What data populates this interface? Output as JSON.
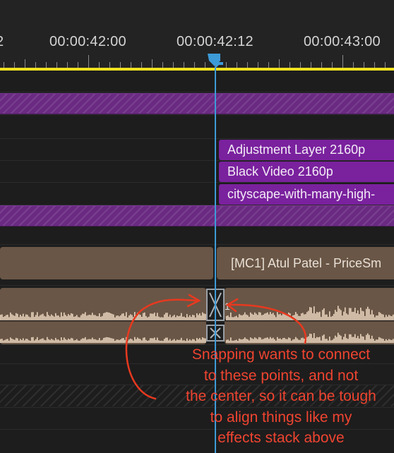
{
  "ruler": {
    "timecodes": [
      "2",
      "00:00:42:00",
      "00:00:42:12",
      "00:00:43:00"
    ]
  },
  "clips": {
    "adjustment_layer": "Adjustment Layer 2160p",
    "black_video": "Black Video 2160p",
    "cityscape": "cityscape-with-many-high-",
    "audio_right": "[MC1] Atul Patel - PriceSm"
  },
  "transition": {
    "number": "1"
  },
  "annotation": {
    "lines": [
      "Snapping wants to connect",
      "to these points, and not",
      "the center, so it can be tough",
      "to align things like my",
      "effects stack above"
    ]
  },
  "colors": {
    "accent_playhead": "#3d9bd8",
    "work_area_bar": "#f0e020",
    "video_clip": "#7a219e",
    "audio_clip": "#6a5646",
    "annotation": "#ef4430"
  }
}
